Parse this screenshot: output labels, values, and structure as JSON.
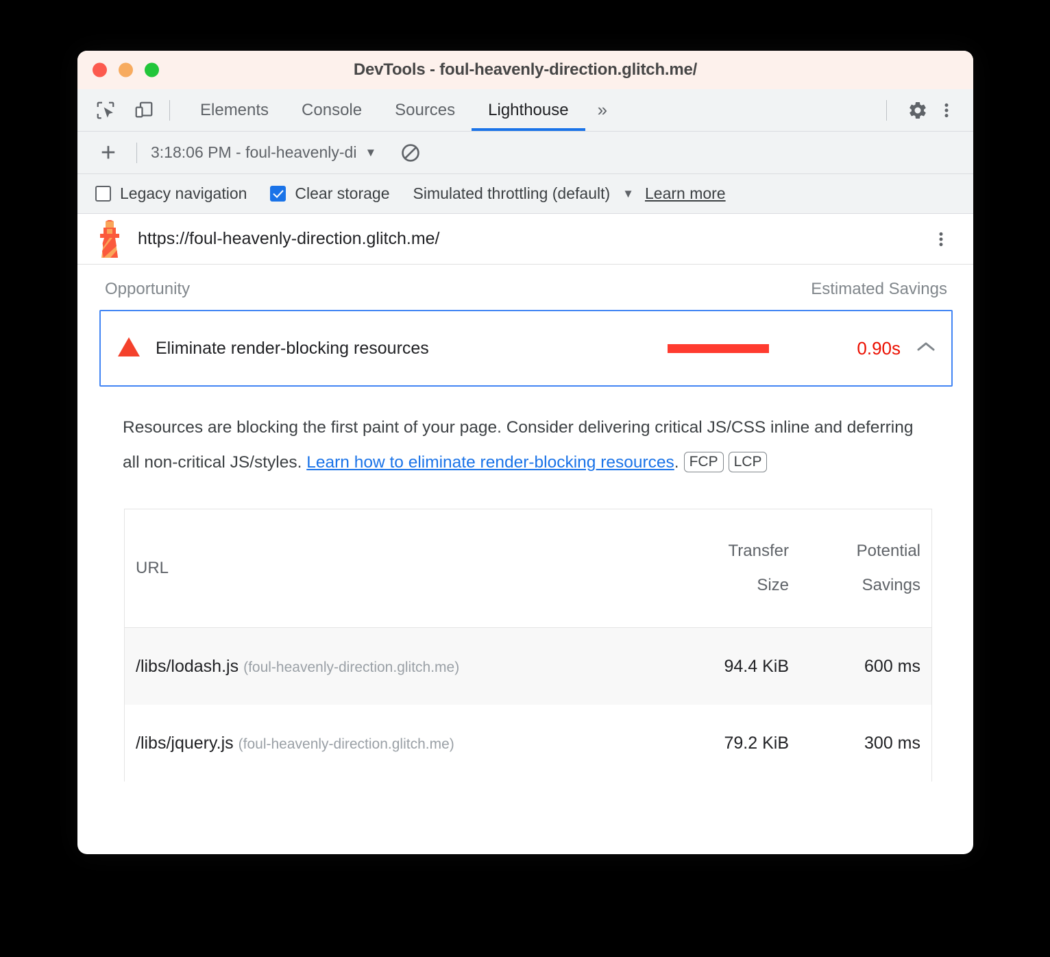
{
  "window": {
    "title": "DevTools - foul-heavenly-direction.glitch.me/",
    "traffic_lights": [
      "close",
      "minimize",
      "maximize"
    ]
  },
  "devtools": {
    "icons": {
      "inspect": "inspect-element-icon",
      "device": "device-toolbar-icon",
      "settings": "gear-icon",
      "more": "more-options-icon"
    },
    "tabs": [
      {
        "label": "Elements",
        "active": false
      },
      {
        "label": "Console",
        "active": false
      },
      {
        "label": "Sources",
        "active": false
      },
      {
        "label": "Lighthouse",
        "active": true
      }
    ],
    "more_tabs_glyph": "»",
    "active_tab_color": "#1a73e8"
  },
  "lighthouse_toolbar": {
    "add_label": "+",
    "report_select": "3:18:06 PM - foul-heavenly-di",
    "caret": "▼",
    "clear_icon": "clear-all-icon"
  },
  "options": {
    "legacy_navigation": {
      "label": "Legacy navigation",
      "checked": false
    },
    "clear_storage": {
      "label": "Clear storage",
      "checked": true
    },
    "throttling": {
      "label": "Simulated throttling (default)",
      "caret": "▼"
    },
    "learn_more": "Learn more"
  },
  "report": {
    "url": "https://foul-heavenly-direction.glitch.me/",
    "logo": "lighthouse-icon",
    "menu_icon": "more-options-icon",
    "columns": {
      "opportunity": "Opportunity",
      "estimated_savings": "Estimated Savings"
    },
    "opportunity": {
      "severity_icon": "warning-triangle-icon",
      "severity_color": "#f4412c",
      "title": "Eliminate render-blocking resources",
      "bar_color": "#ff3b2f",
      "bar_fraction": 0.64,
      "savings_value": "0.90s",
      "savings_color": "#eb0f00",
      "expanded": true,
      "collapse_glyph": "⌃",
      "description_part1": "Resources are blocking the first paint of your page. Consider delivering critical JS/CSS inline and deferring all non-critical JS/styles. ",
      "description_link": "Learn how to eliminate render-blocking resources",
      "description_part2": ".",
      "metric_badges": [
        "FCP",
        "LCP"
      ]
    },
    "table": {
      "headers": {
        "url": "URL",
        "transfer_size_line1": "Transfer",
        "transfer_size_line2": "Size",
        "potential_savings_line1": "Potential",
        "potential_savings_line2": "Savings"
      },
      "rows": [
        {
          "path": "/libs/lodash.js",
          "host": "(foul-heavenly-direction.glitch.me)",
          "transfer_size": "94.4 KiB",
          "potential_savings": "600 ms"
        },
        {
          "path": "/libs/jquery.js",
          "host": "(foul-heavenly-direction.glitch.me)",
          "transfer_size": "79.2 KiB",
          "potential_savings": "300 ms"
        }
      ]
    }
  }
}
